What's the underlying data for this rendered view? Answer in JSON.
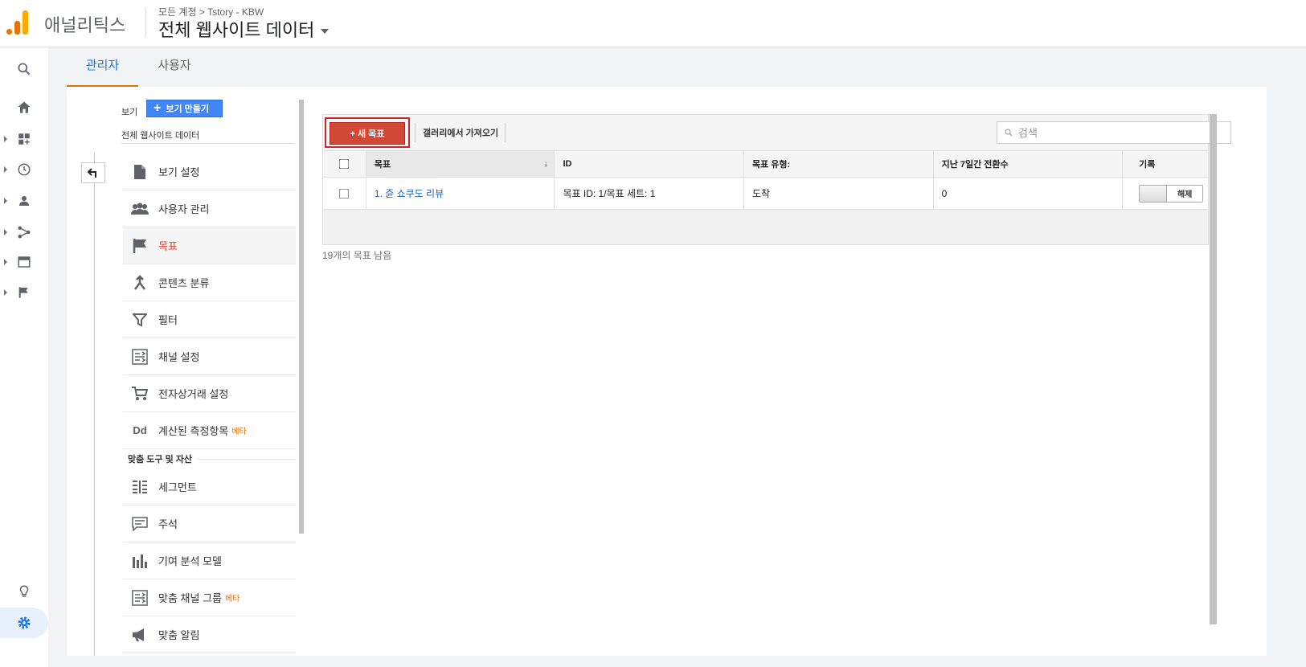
{
  "header": {
    "app_name": "애널리틱스",
    "breadcrumb": "모든 계정 > Tstory - KBW",
    "view_title": "전체 웹사이트 데이터"
  },
  "rail": {
    "items": [
      "search-icon",
      "home-icon",
      "customization-icon",
      "realtime-icon",
      "audience-icon",
      "acquisition-icon",
      "behavior-icon",
      "conversions-icon",
      "lightbulb-icon",
      "settings-icon"
    ]
  },
  "tabs": [
    {
      "label": "관리자"
    },
    {
      "label": "사용자"
    }
  ],
  "sidebar": {
    "view_label": "보기",
    "create_view_label": "보기 만들기",
    "view_name": "전체 웹사이트 데이터",
    "items": [
      {
        "label": "보기 설정",
        "icon": "document-icon"
      },
      {
        "label": "사용자 관리",
        "icon": "users-icon"
      },
      {
        "label": "목표",
        "icon": "flag-icon"
      },
      {
        "label": "콘텐츠 분류",
        "icon": "content-grouping-icon"
      },
      {
        "label": "필터",
        "icon": "filter-icon"
      },
      {
        "label": "채널 설정",
        "icon": "channel-settings-icon"
      },
      {
        "label": "전자상거래 설정",
        "icon": "cart-icon"
      },
      {
        "label": "계산된 측정항목",
        "icon": "dd-icon",
        "badge": "베타"
      }
    ],
    "section_title": "맞춤 도구 및 자산",
    "section_items": [
      {
        "label": "세그먼트",
        "icon": "segments-icon"
      },
      {
        "label": "주석",
        "icon": "annotation-icon"
      },
      {
        "label": "기여 분석 모델",
        "icon": "bar-chart-icon"
      },
      {
        "label": "맞춤 채널 그룹",
        "icon": "channel-group-icon",
        "badge": "베타"
      },
      {
        "label": "맞춤 알림",
        "icon": "megaphone-icon"
      }
    ]
  },
  "toolbar": {
    "new_goal_label": "+ 새 목표",
    "import_gallery_label": "갤러리에서 가져오기",
    "search_placeholder": "검색"
  },
  "table": {
    "headers": [
      "목표",
      "ID",
      "목표 유형:",
      "지난 7일간 전환수",
      "기록"
    ],
    "rows": [
      {
        "goal": "1. 쥰 쇼쿠도 리뷰",
        "id": "목표 ID: 1/목표 세트: 1",
        "type": "도착",
        "conversions": "0",
        "record_toggle": "해제"
      }
    ]
  },
  "remaining_text": "19개의 목표 남음",
  "colors": {
    "accent_blue": "#1a73e8",
    "brand_orange": "#e37400",
    "new_goal_red": "#d14836",
    "highlight_border": "#c62828"
  }
}
